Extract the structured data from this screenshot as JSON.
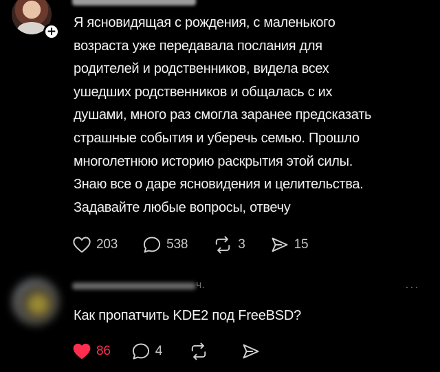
{
  "post": {
    "follow_symbol": "+",
    "lines": [
      "Я ясновидящая с рождения, с маленького",
      "возраста уже передавала послания для",
      "родителей и родственников, видела всех",
      "ушедших родственников и общалась с их",
      "душами, много раз смогла заранее предсказать",
      "страшные события и уберечь семью. Прошло",
      "многолетнюю историю раскрытия этой силы.",
      "Знаю все о даре ясновидения и целительства.",
      "Задавайте любые вопросы, отвечу"
    ],
    "stats": {
      "likes": "203",
      "comments": "538",
      "reposts": "3",
      "shares": "15"
    }
  },
  "reply": {
    "time": "ч.",
    "more": "···",
    "text": "Как пропатчить KDE2 под FreeBSD?",
    "stats": {
      "likes": "86",
      "comments": "4"
    },
    "like_color": "#ff2e4f"
  }
}
